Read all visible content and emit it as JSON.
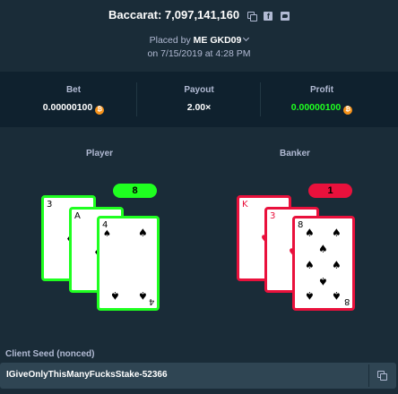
{
  "header": {
    "title": "Baccarat: 7,097,141,160",
    "placed_prefix": "Placed by",
    "user": "ME GKD09",
    "date": "on 7/15/2019 at 4:28 PM"
  },
  "stats": {
    "bet_label": "Bet",
    "bet_value": "0.00000100",
    "payout_label": "Payout",
    "payout_value": "2.00×",
    "profit_label": "Profit",
    "profit_value": "0.00000100",
    "currency_glyph": "₿",
    "profit_color": "#1fff20"
  },
  "player": {
    "label": "Player",
    "score": "8",
    "color": "#1fff20",
    "cards": [
      {
        "rank": "3",
        "suit": "♦"
      },
      {
        "rank": "A",
        "suit": "♦"
      },
      {
        "rank": "4",
        "suit": "♠"
      }
    ]
  },
  "banker": {
    "label": "Banker",
    "score": "1",
    "color": "#e9113c",
    "cards": [
      {
        "rank": "K",
        "suit": "♥"
      },
      {
        "rank": "3",
        "suit": "♥"
      },
      {
        "rank": "8",
        "suit": "♠"
      }
    ]
  },
  "seed": {
    "label": "Client Seed (nonced)",
    "value": "IGiveOnlyThisManyFucksStake-52366"
  }
}
